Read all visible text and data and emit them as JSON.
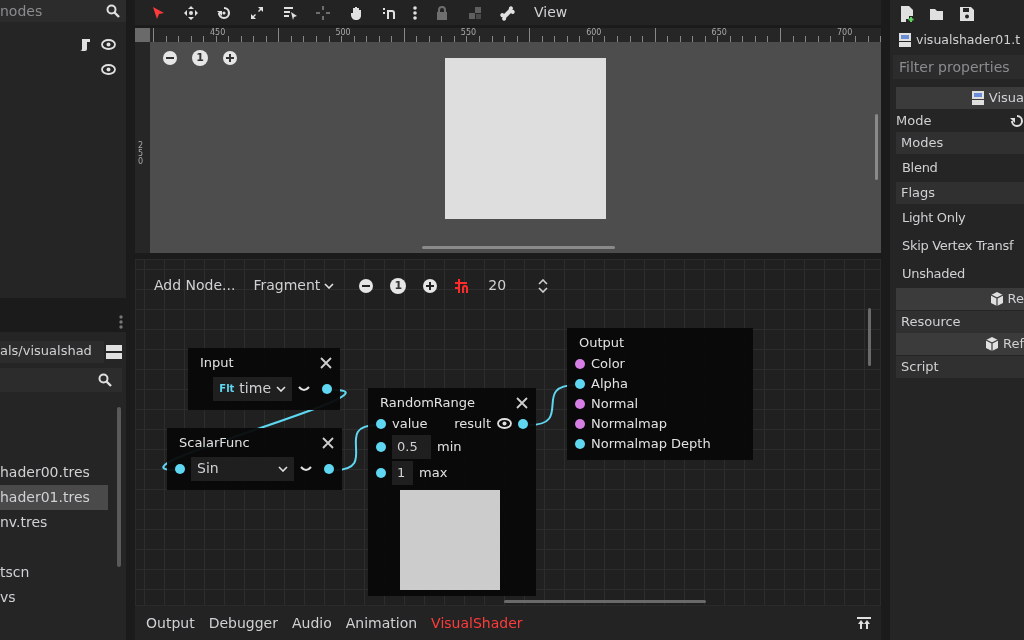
{
  "scene_dock": {
    "filter_placeholder": "nodes",
    "rows": [
      {
        "script": true
      },
      {
        "script": false
      }
    ]
  },
  "file_dock": {
    "path": "als/visualshad",
    "files": [
      {
        "name": "hader00.tres",
        "selected": false
      },
      {
        "name": "hader01.tres",
        "selected": true
      },
      {
        "name": "nv.tres",
        "selected": false
      },
      {
        "name": "tscn",
        "selected": false
      },
      {
        "name": "vs",
        "selected": false
      }
    ]
  },
  "toolbar": {
    "tools": [
      {
        "kind": "select",
        "selected": true,
        "disabled": false
      },
      {
        "kind": "move",
        "selected": false,
        "disabled": false
      },
      {
        "kind": "rotate",
        "selected": false,
        "disabled": false
      },
      {
        "kind": "scale",
        "selected": false,
        "disabled": false
      },
      {
        "kind": "list",
        "selected": false,
        "disabled": false
      },
      {
        "kind": "pivot",
        "selected": false,
        "disabled": true
      },
      {
        "kind": "pan",
        "selected": false,
        "disabled": false
      },
      {
        "kind": "snap",
        "selected": false,
        "disabled": false
      },
      {
        "kind": "more",
        "selected": false,
        "disabled": false
      },
      {
        "kind": "lock",
        "selected": false,
        "disabled": true
      },
      {
        "kind": "group",
        "selected": false,
        "disabled": true
      },
      {
        "kind": "bone",
        "selected": false,
        "disabled": false
      }
    ],
    "view_menu": "View"
  },
  "ruler": {
    "x_labels": [
      "450",
      "500",
      "550",
      "600",
      "650",
      "700"
    ],
    "y_labels": [
      "250"
    ]
  },
  "viewport": {
    "zoom_reset_label": "1"
  },
  "graph": {
    "add_node": "Add Node...",
    "mode": "Fragment",
    "zoom_reset_label": "1",
    "snap": true,
    "snap_step": "20",
    "nodes": [
      {
        "title": "Input",
        "closable": true,
        "rows": [
          {
            "kind": "select",
            "type_tag": "Flt",
            "value": "time",
            "out_port": {
              "color": "#5fd7f2"
            }
          }
        ]
      },
      {
        "title": "ScalarFunc",
        "closable": true,
        "rows": [
          {
            "kind": "select",
            "value": "Sin",
            "in_port": {
              "color": "#5fd7f2"
            },
            "out_port": {
              "color": "#5fd7f2"
            }
          }
        ]
      },
      {
        "title": "RandomRange",
        "closable": true,
        "rows": [
          {
            "kind": "port",
            "label": "value",
            "in_port": {
              "color": "#5fd7f2"
            },
            "out_label": "result",
            "preview_toggle": true,
            "out_port": {
              "color": "#5fd7f2"
            }
          },
          {
            "kind": "param",
            "value": "0.5",
            "label": "min",
            "in_port": {
              "color": "#5fd7f2"
            }
          },
          {
            "kind": "param",
            "value": "1",
            "label": "max",
            "in_port": {
              "color": "#5fd7f2"
            }
          },
          {
            "kind": "preview"
          }
        ]
      },
      {
        "title": "Output",
        "closable": false,
        "rows": [
          {
            "kind": "port",
            "label": "Color",
            "in_port": {
              "color": "#d67ee6"
            }
          },
          {
            "kind": "port",
            "label": "Alpha",
            "in_port": {
              "color": "#5fd7f2"
            }
          },
          {
            "kind": "port",
            "label": "Normal",
            "in_port": {
              "color": "#d67ee6"
            }
          },
          {
            "kind": "port",
            "label": "Normalmap",
            "in_port": {
              "color": "#d67ee6"
            }
          },
          {
            "kind": "port",
            "label": "Normalmap Depth",
            "in_port": {
              "color": "#5fd7f2"
            }
          }
        ]
      }
    ],
    "wired": true
  },
  "bottom_panel": {
    "tabs": [
      {
        "label": "Output",
        "selected": false
      },
      {
        "label": "Debugger",
        "selected": false
      },
      {
        "label": "Audio",
        "selected": false
      },
      {
        "label": "Animation",
        "selected": false
      },
      {
        "label": "VisualShader",
        "selected": true
      }
    ]
  },
  "inspector": {
    "resource": "visualshader01.t",
    "filter_placeholder": "Filter properties",
    "rows": [
      {
        "kind": "resource_header",
        "label": "Visua"
      },
      {
        "kind": "field",
        "label": "Mode"
      },
      {
        "kind": "section",
        "label": "Modes"
      },
      {
        "kind": "property",
        "label": "Blend"
      },
      {
        "kind": "section",
        "label": "Flags"
      },
      {
        "kind": "property",
        "label": "Light Only"
      },
      {
        "kind": "property",
        "label": "Skip Vertex Transf"
      },
      {
        "kind": "property",
        "label": "Unshaded"
      },
      {
        "kind": "header",
        "label": "Re"
      },
      {
        "kind": "section",
        "label": "Resource"
      },
      {
        "kind": "header",
        "label": "Ref"
      },
      {
        "kind": "section",
        "label": "Script"
      }
    ]
  }
}
